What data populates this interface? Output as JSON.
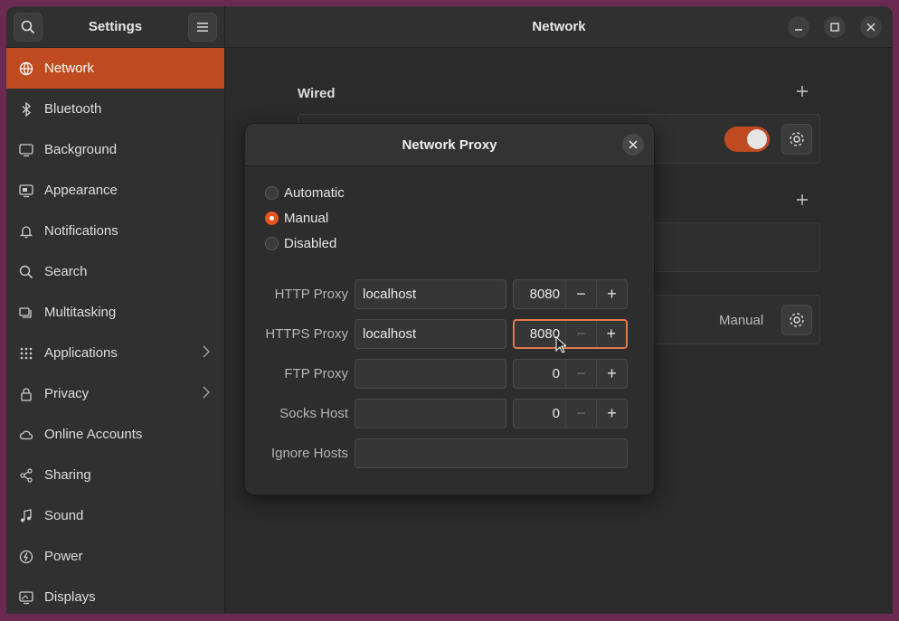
{
  "sidebar": {
    "title": "Settings",
    "search_icon": "search-icon",
    "menu_icon": "hamburger-menu-icon",
    "items": [
      {
        "label": "Network",
        "icon": "network-globe-icon",
        "active": true
      },
      {
        "label": "Bluetooth",
        "icon": "bluetooth-icon"
      },
      {
        "label": "Background",
        "icon": "background-icon"
      },
      {
        "label": "Appearance",
        "icon": "appearance-icon"
      },
      {
        "label": "Notifications",
        "icon": "bell-icon"
      },
      {
        "label": "Search",
        "icon": "search-icon"
      },
      {
        "label": "Multitasking",
        "icon": "multitasking-icon"
      },
      {
        "label": "Applications",
        "icon": "apps-grid-icon",
        "chevron": true
      },
      {
        "label": "Privacy",
        "icon": "lock-icon",
        "chevron": true
      },
      {
        "label": "Online Accounts",
        "icon": "cloud-icon"
      },
      {
        "label": "Sharing",
        "icon": "share-icon"
      },
      {
        "label": "Sound",
        "icon": "music-note-icon"
      },
      {
        "label": "Power",
        "icon": "power-icon"
      },
      {
        "label": "Displays",
        "icon": "display-icon"
      }
    ]
  },
  "main": {
    "title": "Network",
    "wired_title": "Wired",
    "proxy_mode_value": "Manual"
  },
  "dialog": {
    "title": "Network Proxy",
    "modes": [
      {
        "label": "Automatic",
        "checked": false
      },
      {
        "label": "Manual",
        "checked": true
      },
      {
        "label": "Disabled",
        "checked": false
      }
    ],
    "rows": [
      {
        "label": "HTTP Proxy",
        "host": "localhost",
        "port": "8080"
      },
      {
        "label": "HTTPS Proxy",
        "host": "localhost",
        "port": "8080"
      },
      {
        "label": "FTP Proxy",
        "host": "",
        "port": "0"
      },
      {
        "label": "Socks Host",
        "host": "",
        "port": "0"
      }
    ],
    "ignore_label": "Ignore Hosts",
    "ignore_value": ""
  },
  "colors": {
    "accent": "#c04b20",
    "focus": "#e07a4f"
  }
}
